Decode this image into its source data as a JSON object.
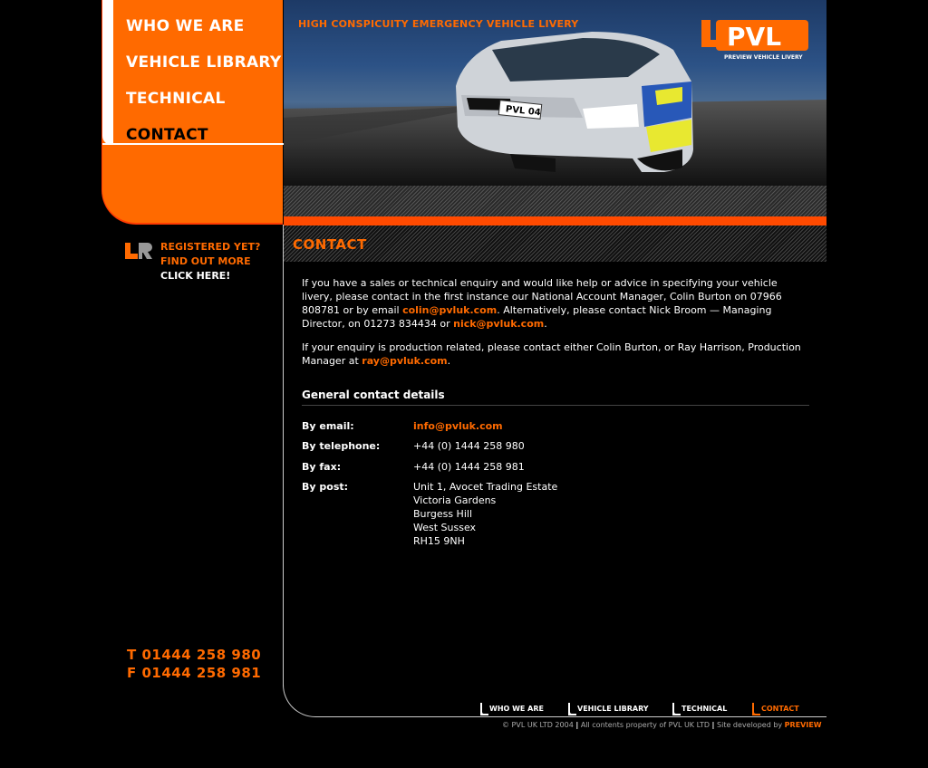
{
  "nav": {
    "items": [
      {
        "label": "WHO WE ARE"
      },
      {
        "label": "VEHICLE LIBRARY"
      },
      {
        "label": "TECHNICAL"
      },
      {
        "label": "CONTACT"
      }
    ]
  },
  "promo": {
    "line1": "REGISTERED YET?",
    "line2": "FIND OUT MORE",
    "line3": "CLICK HERE!"
  },
  "phones": {
    "tel": "T 01444 258 980",
    "fax": "F 01444 258 981"
  },
  "hero": {
    "tagline": "HIGH CONSPICUITY EMERGENCY VEHICLE LIVERY",
    "logo_text": "PVL",
    "logo_sub": "PREVIEW VEHICLE LIVERY",
    "plate": "PVL 04"
  },
  "section": {
    "title": "CONTACT"
  },
  "content": {
    "p1_a": "If you have a sales or technical enquiry and would like help or advice in specifying your vehicle livery, please contact in the first instance our National Account Manager, Colin Burton on 07966 808781 or by email ",
    "p1_email1": "colin@pvluk.com",
    "p1_b": ". Alternatively, please contact Nick Broom — Managing Director, on 01273 834434 or ",
    "p1_email2": "nick@pvluk.com",
    "p1_c": ".",
    "p2_a": "If your enquiry is production related, please contact either Colin Burton, or Ray Harrison, Production Manager at ",
    "p2_email": "ray@pvluk.com",
    "p2_b": ".",
    "gcd_title": "General contact details",
    "email_label": "By email:",
    "email_value": "info@pvluk.com",
    "tel_label": "By telephone:",
    "tel_value": "+44 (0) 1444 258 980",
    "fax_label": "By fax:",
    "fax_value": "+44 (0) 1444 258 981",
    "post_label": "By post:",
    "post_lines": [
      "Unit 1, Avocet Trading Estate",
      "Victoria Gardens",
      "Burgess Hill",
      "West Sussex",
      "RH15 9NH"
    ]
  },
  "footer_nav": [
    {
      "label": "WHO WE ARE"
    },
    {
      "label": "VEHICLE LIBRARY"
    },
    {
      "label": "TECHNICAL"
    },
    {
      "label": "CONTACT"
    }
  ],
  "footer": {
    "copy": "© PVL UK LTD 2004",
    "rights": "All contents property of PVL UK LTD",
    "dev": "Site developed by",
    "brand": "PREVIEW"
  },
  "colors": {
    "accent": "#ff6a00",
    "accent_dark": "#ff3a00",
    "background": "#000000"
  }
}
